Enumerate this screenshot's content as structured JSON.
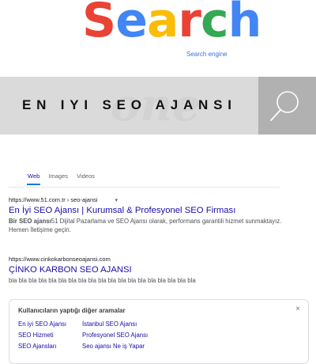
{
  "logo": {
    "letters": [
      {
        "char": "S",
        "color": "#ea4335"
      },
      {
        "char": "e",
        "color": "#4285f4"
      },
      {
        "char": "a",
        "color": "#fbbc05"
      },
      {
        "char": "r",
        "color": "#ea4335"
      },
      {
        "char": "c",
        "color": "#34a853"
      },
      {
        "char": "h",
        "color": "#4285f4"
      }
    ],
    "tagline": "Search engine"
  },
  "search": {
    "query": "EN IYI SEO AJANSI",
    "watermark": "one",
    "icon": "magnifier-icon"
  },
  "tabs": [
    {
      "label": "Web",
      "active": true
    },
    {
      "label": "Images",
      "active": false
    },
    {
      "label": "Videos",
      "active": false
    }
  ],
  "results": [
    {
      "url": "https://www.51.com.tr › seo-ajansi",
      "title": "En İyi SEO Ajansı | Kurumsal & Profesyonel SEO Firması",
      "snippet_bold": "Bir SEO ajansı",
      "snippet": "51 Dijital Pazarlama ve SEO Ajansı olarak, performans garantili hizmet sunmaktayız. Hemen İletişime geçin."
    },
    {
      "url": "https://www.cinkokarbonseoajansi.com",
      "title": "ÇİNKO KARBON SEO AJANSI",
      "snippet_bold": "",
      "snippet": "bla bla bla bla bla bla bla bla bla bla bla bla bla bla bla bla bla bla bla"
    }
  ],
  "related": {
    "heading": "Kullanıcıların yaptığı diğer aramalar",
    "close": "×",
    "items": [
      "En iyi SEO Ajansı",
      "İstanbul SEO Ajansı",
      "SEO Hizmeti",
      "Profesyonel SEO Ajansı",
      "SEO Ajansları",
      "Seo ajansı Ne iş Yapar"
    ]
  }
}
